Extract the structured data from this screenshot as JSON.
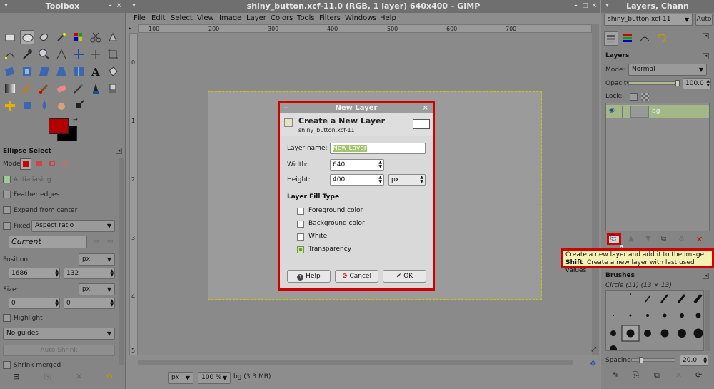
{
  "toolbox": {
    "title": "Toolbox",
    "options_title": "Ellipse Select",
    "mode_label": "Mode:",
    "antialiasing": "Antialiasing",
    "feather_edges": "Feather edges",
    "expand_from_center": "Expand from center",
    "fixed_label": "Fixed:",
    "fixed_value": "Aspect ratio",
    "current_value": "Current",
    "position_label": "Position:",
    "position_unit": "px",
    "position_x": "1686",
    "position_y": "132",
    "size_label": "Size:",
    "size_unit": "px",
    "size_w": "0",
    "size_h": "0",
    "highlight": "Highlight",
    "guides_value": "No guides",
    "auto_shrink": "Auto Shrink",
    "shrink_merged": "Shrink merged",
    "fg_color": "#b30000",
    "bg_color": "#000000"
  },
  "image_window": {
    "title": "shiny_button.xcf-11.0 (RGB, 1 layer) 640x400 – GIMP",
    "menus": [
      "File",
      "Edit",
      "Select",
      "View",
      "Image",
      "Layer",
      "Colors",
      "Tools",
      "Filters",
      "Windows",
      "Help"
    ],
    "ruler_h": [
      "100",
      "200",
      "300",
      "400",
      "500",
      "600",
      "700"
    ],
    "ruler_v": [
      "0",
      "1",
      "2",
      "3",
      "4",
      "5"
    ],
    "status_unit": "px",
    "zoom": "100 %",
    "status_text": "bg (3.3 MB)"
  },
  "dialog": {
    "title": "New Layer",
    "header_title": "Create a New Layer",
    "header_subtitle": "shiny_button.xcf-11",
    "layer_name_label": "Layer name:",
    "layer_name_value": "New Layer",
    "width_label": "Width:",
    "width_value": "640",
    "height_label": "Height:",
    "height_value": "400",
    "unit_value": "px",
    "fill_type_label": "Layer Fill Type",
    "fill_options": [
      "Foreground color",
      "Background color",
      "White",
      "Transparency"
    ],
    "fill_selected": "Transparency",
    "help_label": "Help",
    "cancel_label": "Cancel",
    "ok_label": "OK"
  },
  "dock": {
    "title": "Layers, Chann",
    "image_combo": "shiny_button.xcf-11",
    "auto_label": "Auto",
    "layers_title": "Layers",
    "mode_label": "Mode:",
    "mode_value": "Normal",
    "opacity_label": "Opacity:",
    "opacity_value": "100.0",
    "lock_label": "Lock:",
    "layer_name": "bg",
    "brushes_title": "Brushes",
    "brush_name": "Circle (11) (13 × 13)",
    "spacing_label": "Spacing:",
    "spacing_value": "20.0"
  },
  "tooltip": {
    "line1": "Create a new layer and add it to the image",
    "line2_key": "Shift",
    "line2_text": "Create a new layer with last used values"
  }
}
